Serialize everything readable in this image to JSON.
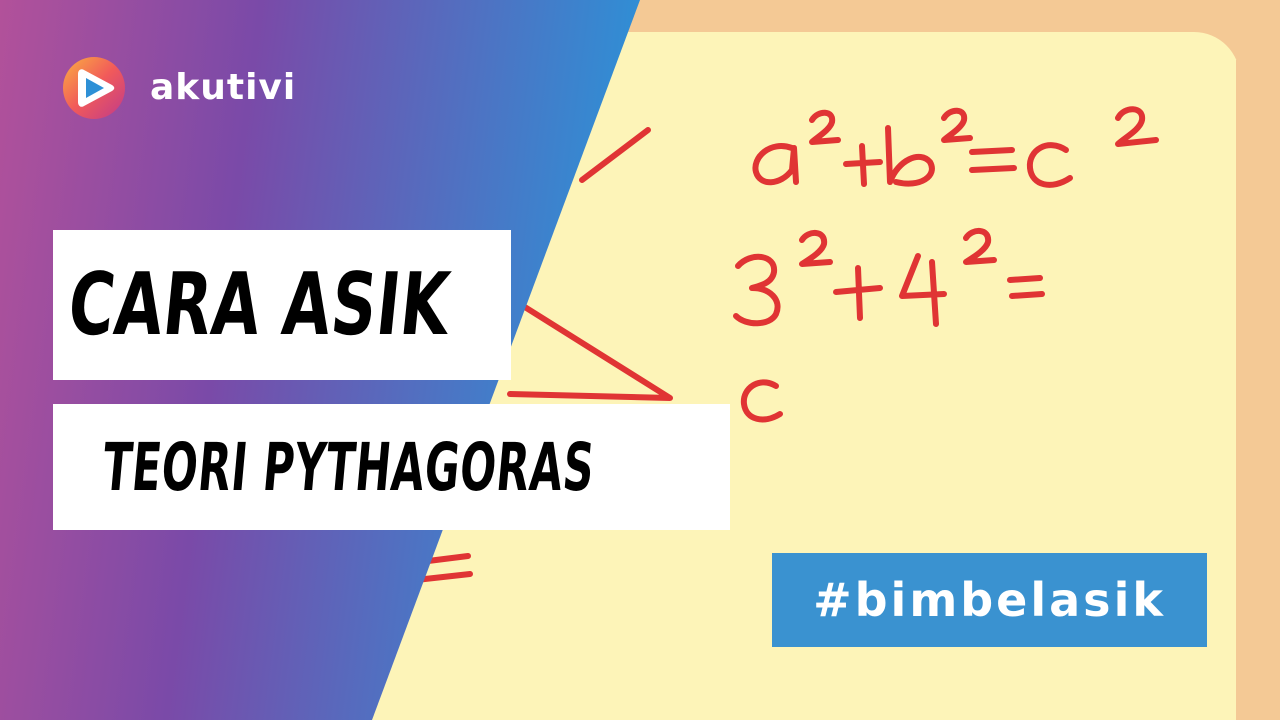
{
  "brand": {
    "name": "akutivi",
    "logo_icon": "play-triangle-icon"
  },
  "title": {
    "line1": "CARA ASIK",
    "line2": "TEORI PYTHAGORAS"
  },
  "board": {
    "equation_line1": "a²+b²=c²",
    "equation_line2": "3²+4²=",
    "side_label": "c",
    "ink_color": "#e03434",
    "paper_color": "#fdf4b8"
  },
  "hashtag": "#bimbelasik",
  "colors": {
    "gradient_start": "#b2519a",
    "gradient_mid": "#7a4aa8",
    "gradient_end": "#2e90d6",
    "hashtag_bg": "#3a92d0",
    "title_bg": "#ffffff",
    "title_text": "#000000",
    "background": "#f4c995"
  }
}
